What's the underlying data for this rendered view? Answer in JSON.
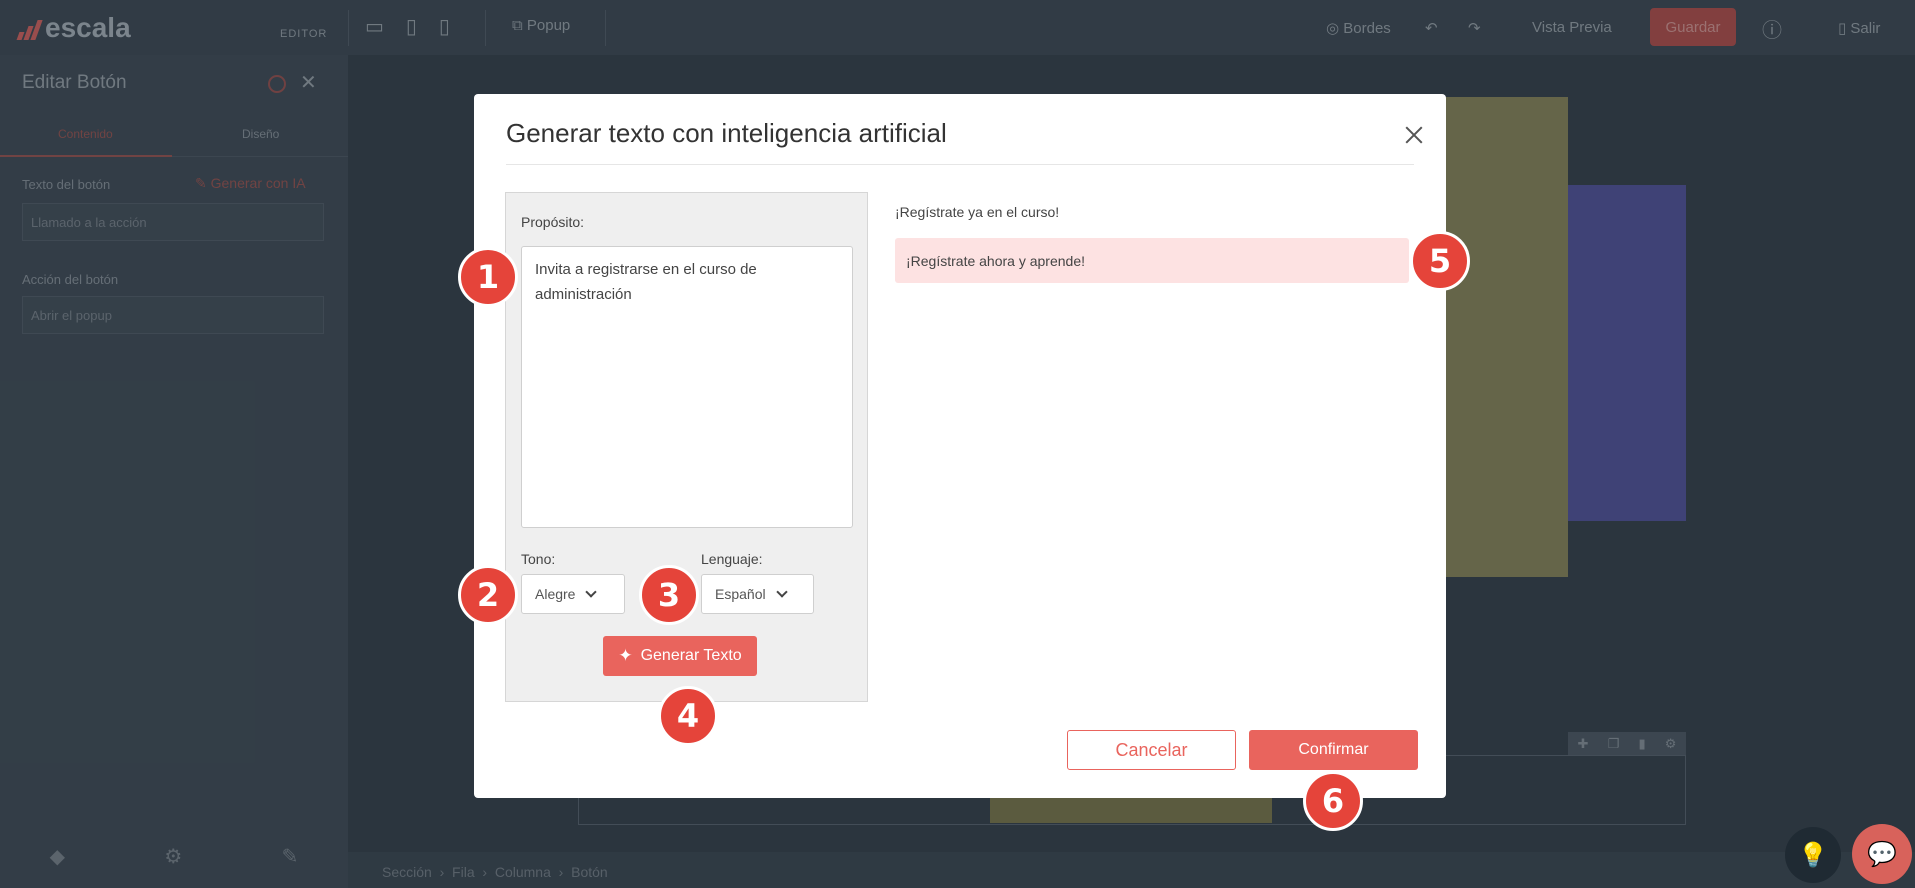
{
  "editor": {
    "logo_text": "escala",
    "logo_tag": "EDITOR",
    "popup_label": "Popup",
    "bordes_label": "Bordes",
    "preview_label": "Vista Previa",
    "save_label": "Guardar",
    "exit_label": "Salir"
  },
  "sidebar": {
    "title": "Editar Botón",
    "tabs": [
      "Contenido",
      "Diseño"
    ],
    "button_text_label": "Texto del botón",
    "ai_link": "Generar con IA",
    "button_text_value": "Llamado a la acción",
    "action_label": "Acción del botón",
    "action_value": "Abrir el popup"
  },
  "breadcrumb": [
    "Sección",
    "Fila",
    "Columna",
    "Botón"
  ],
  "modal": {
    "title": "Generar texto con inteligencia artificial",
    "purpose_label": "Propósito:",
    "purpose_value": "Invita a registrarse en el curso de administración",
    "tone_label": "Tono:",
    "tone_value": "Alegre",
    "language_label": "Lenguaje:",
    "language_value": "Español",
    "generate_label": "Generar Texto",
    "results": [
      "¡Regístrate ya en el curso!",
      "¡Regístrate ahora y aprende!"
    ],
    "cancel_label": "Cancelar",
    "confirm_label": "Confirmar"
  },
  "badges": [
    "1",
    "2",
    "3",
    "4",
    "5",
    "6"
  ],
  "colors": {
    "accent": "#e9645d",
    "badge": "#e5443a",
    "selected_result": "#fde2e2"
  }
}
